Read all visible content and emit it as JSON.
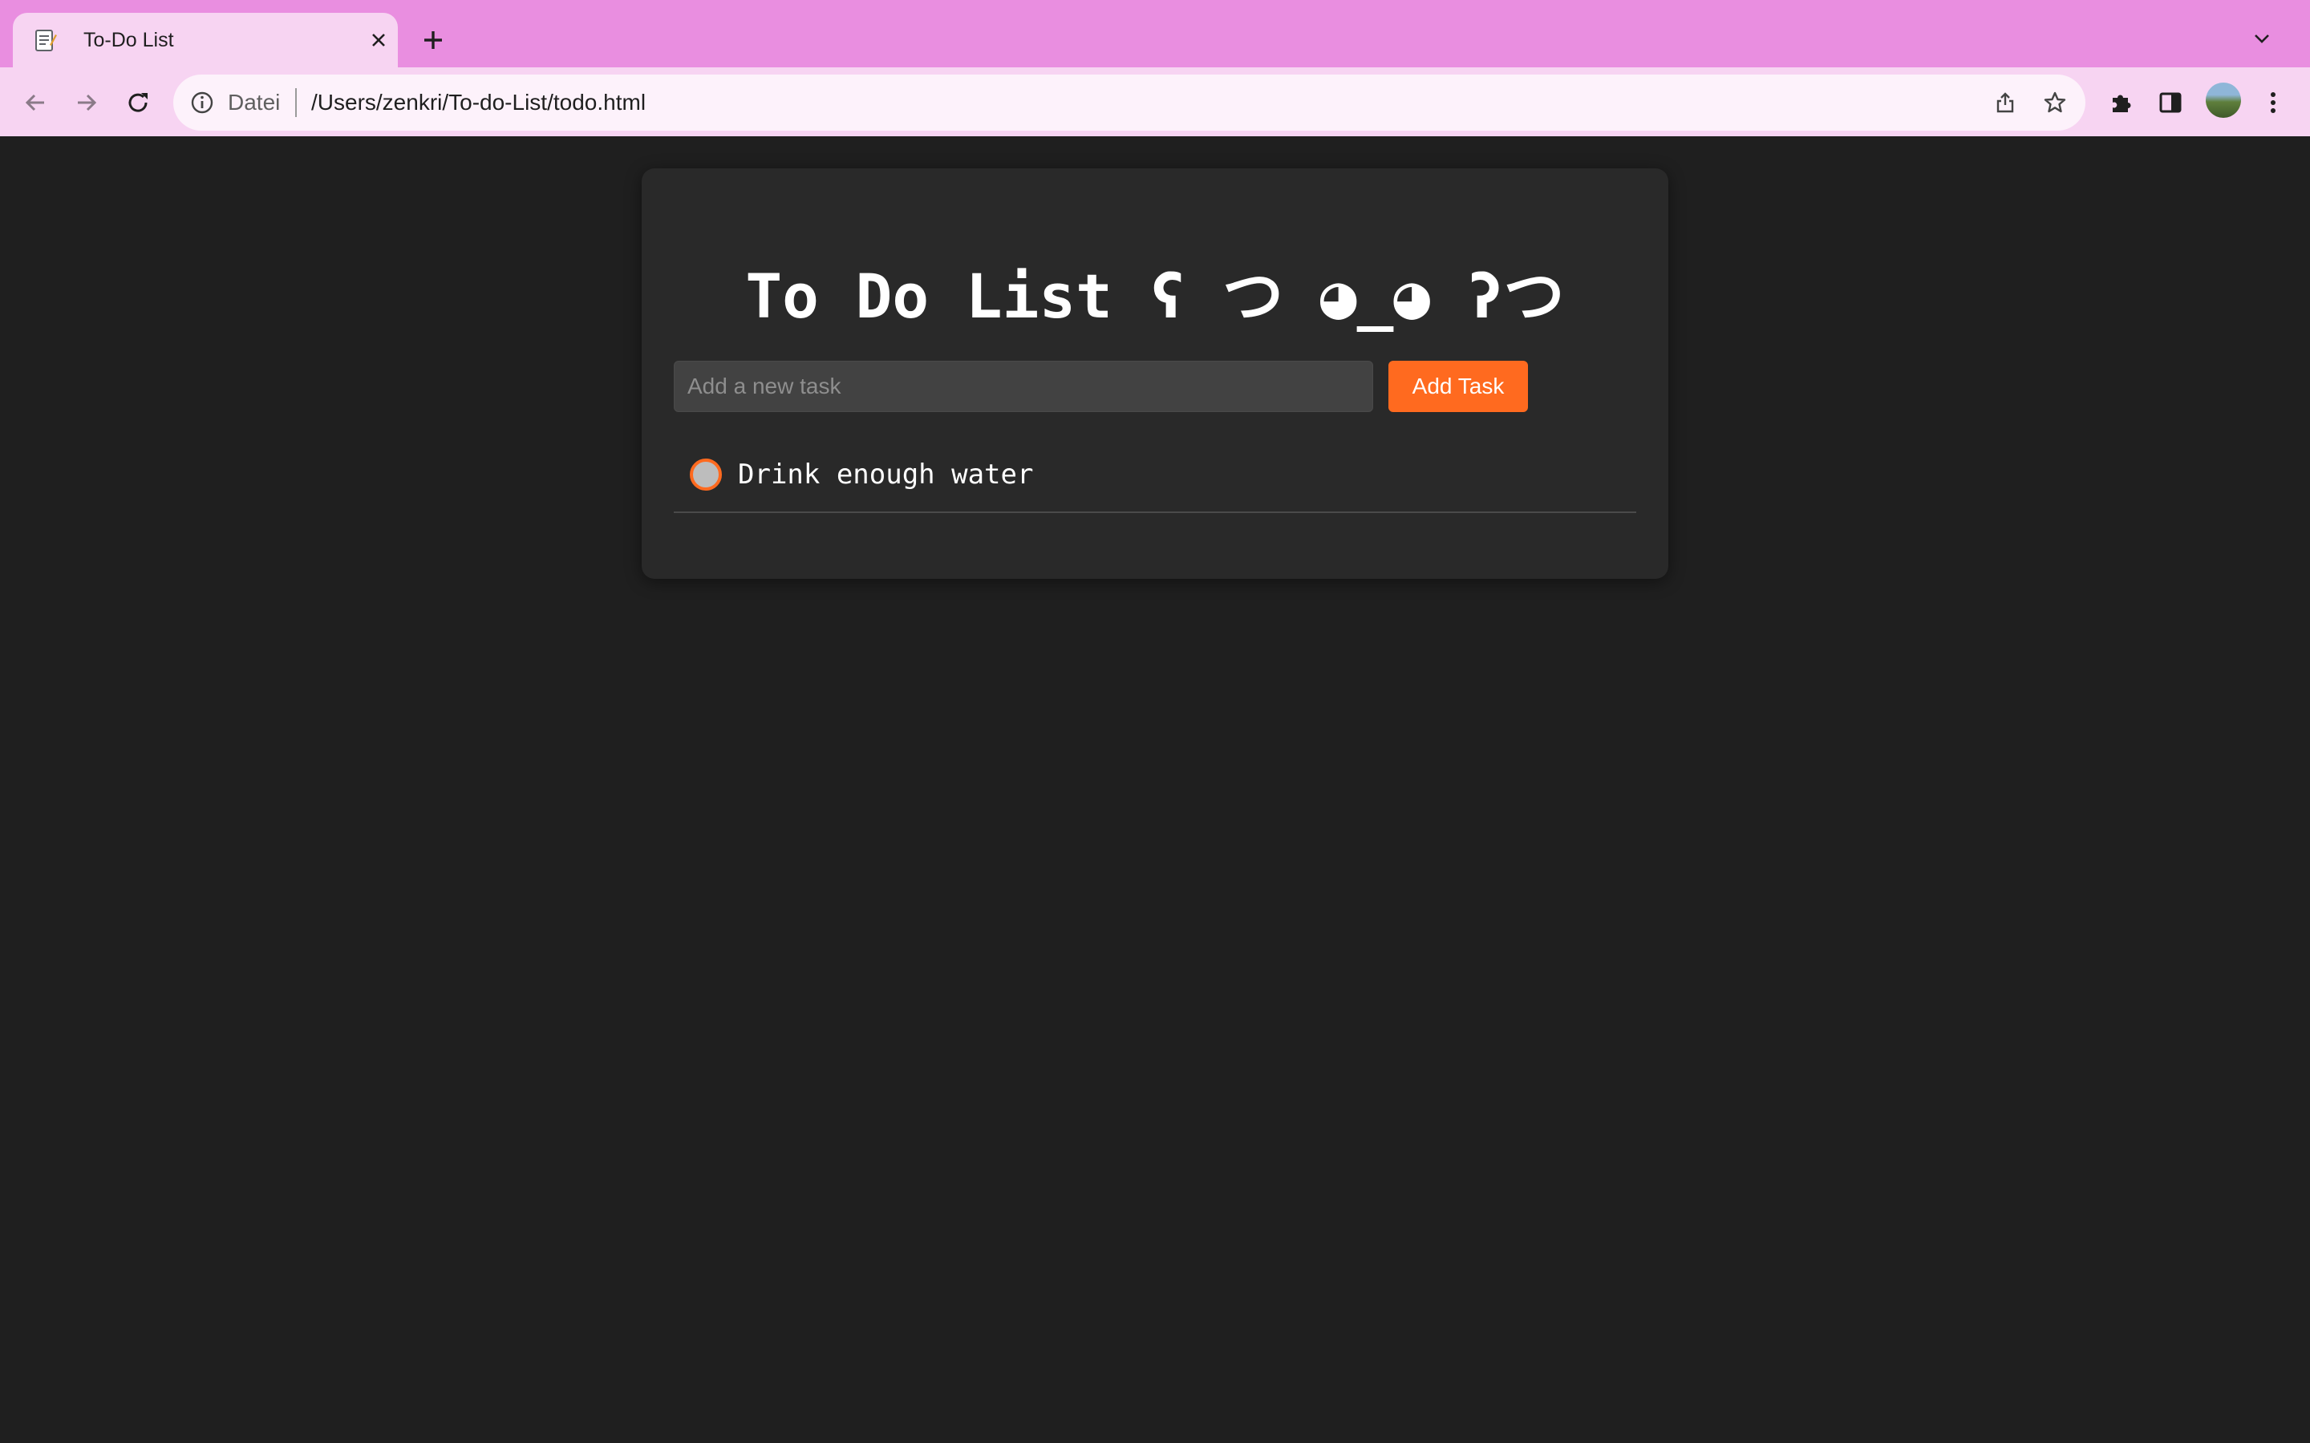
{
  "browser": {
    "tab": {
      "title": "To-Do List",
      "favicon": "notepad-icon"
    },
    "scheme_label": "Datei",
    "url": "/Users/zenkri/To-do-List/todo.html",
    "theme_color": "#e98ee0",
    "icons": [
      "back-icon",
      "forward-icon",
      "reload-icon",
      "site-info-icon",
      "share-icon",
      "bookmark-star-icon",
      "extensions-icon",
      "side-panel-icon",
      "profile-avatar",
      "more-menu-icon",
      "new-tab-icon",
      "tab-list-icon",
      "close-icon"
    ]
  },
  "app": {
    "heading": "To Do List ʕ つ ◕_◕ ʔつ",
    "input": {
      "placeholder": "Add a new task",
      "value": ""
    },
    "add_button_label": "Add Task",
    "tasks": [
      {
        "text": "Drink enough water",
        "completed": false
      }
    ],
    "accent_color": "#ff6a1f",
    "background_color": "#1f1f1f",
    "card_color": "#292929"
  }
}
